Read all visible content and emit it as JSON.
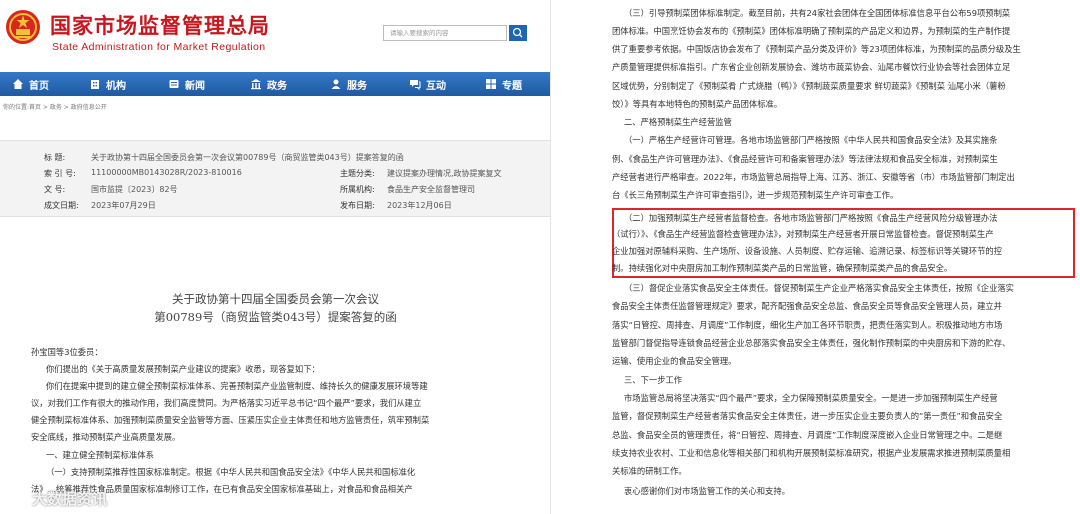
{
  "site": {
    "name_cn": "国家市场监督管理总局",
    "name_en": "State Administration for Market Regulation",
    "search_placeholder": "请输入要搜索的内容"
  },
  "nav": [
    {
      "label": "首页",
      "icon": "home-icon"
    },
    {
      "label": "机构",
      "icon": "building-icon"
    },
    {
      "label": "新闻",
      "icon": "news-icon"
    },
    {
      "label": "政务",
      "icon": "government-icon"
    },
    {
      "label": "服务",
      "icon": "service-icon"
    },
    {
      "label": "互动",
      "icon": "interaction-icon"
    },
    {
      "label": "专题",
      "icon": "topic-icon"
    }
  ],
  "breadcrumb": "你的位置:首页 > 政务 > 政府信息公开",
  "meta": {
    "title_label": "标 题:",
    "title_value": "关于政协第十四届全国委员会第一次会议第00789号（商贸监管类043号）提案答复的函",
    "index_label": "索 引 号:",
    "index_value": "11100000MB0143028R/2023-810016",
    "subject_label": "主题分类:",
    "subject_value": "建议提案办理情况,政协提案复文",
    "docno_label": "文 号:",
    "docno_value": "国市监提〔2023〕82号",
    "org_label": "所属机构:",
    "org_value": "食品生产安全监督管理司",
    "created_label": "成文日期:",
    "created_value": "2023年07月29日",
    "published_label": "发布日期:",
    "published_value": "2023年12月06日"
  },
  "document_title": {
    "line1": "关于政协第十四届全国委员会第一次会议",
    "line2": "第00789号（商贸监管类043号）提案答复的函"
  },
  "left_body": [
    "孙宝国等3位委员：",
    "你们提出的《关于高质量发展预制菜产业建议的提案》收悉，现答复如下：",
    "你们在提案中提到的建立健全预制菜标准体系、完善预制菜产业监管制度、维持长久的健康发展环境等建",
    "议，对我们工作有很大的推动作用，我们高度赞同。为严格落实习近平总书记“四个最严”要求，我们从建立",
    "健全预制菜标准体系、加强预制菜质量安全监管等方面、压紧压实企业主体责任和地方监管责任，筑牢预制菜",
    "安全底线，推动预制菜产业高质量发展。",
    "一、建立健全预制菜标准体系",
    "（一）支持预制菜推荐性国家标准制定。根据《中华人民共和国食品安全法》《中华人民共和国标准化",
    "法》…统筹推荐性食品质量国家标准制修订工作，在已有食品安全国家标准基础上，对食品和食品相关产"
  ],
  "right_body": [
    "（三）引导预制菜团体标准制定。截至目前，共有24家社会团体在全国团体标准信息平台公布59项预制菜",
    "团体标准。中国烹饪协会发布的《预制菜》团体标准明确了预制菜的产品定义和边界，为预制菜的生产制作提",
    "供了重要参考依据。中国饭店协会发布了《预制菜产品分类及评价》等23项团体标准，为预制菜的品质分级及生",
    "产质量管理提供标准指引。广东省企业创新发展协会、潍坊市蔬菜协会、汕尾市餐饮行业协会等社会团体立足",
    "区域优势，分别制定了《预制菜肴 广式烧腊（鸭）》《预制蔬菜质量要求 鲜切蔬菜》《预制菜 汕尾小米（薯粉",
    "饺）》等具有本地特色的预制菜产品团体标准。",
    "二、严格预制菜生产经营监管",
    "（一）严格生产经营许可管理。各地市场监管部门严格按照《中华人民共和国食品安全法》及其实施条",
    "例、《食品生产许可管理办法》、《食品经营许可和备案管理办法》等法律法规和食品安全标准，对预制菜生",
    "产经营者进行严格审查。2022年，市场监管总局指导上海、江苏、浙江、安徽等省（市）市场监管部门制定出",
    "台《长三角预制菜生产许可审查指引》，进一步规范预制菜生产许可审查工作。",
    "（二）加强预制菜生产经营者监督检查。各地市场监管部门严格按照《食品生产经营风险分级管理办法",
    "（试行）》、《食品生产经营监督检查管理办法》，对预制菜生产经营者开展日常监督检查。督促预制菜生产",
    "企业加强对原辅料采购、生产场所、设备设施、人员制度、贮存运输、追溯记录、标签标识等关键环节的控",
    "制。持续强化对中央厨房加工制作预制菜类产品的日常监管，确保预制菜类产品的食品安全。",
    "（三）督促企业落实食品安全主体责任。督促预制菜生产企业严格落实食品安全主体责任，按照《企业落实",
    "食品安全主体责任监督管理规定》要求，配齐配强食品安全总监、食品安全员等食品安全管理人员，建立并",
    "落实“日管控、周排查、月调度”工作制度，细化生产加工各环节职责，把责任落实到人。积极推动地方市场",
    "监管部门督促指导连锁食品经营企业总部落实食品安全主体责任，强化制作预制菜的中央厨房和下游的贮存、",
    "运输、使用企业的食品安全管理。",
    "三、下一步工作",
    "市场监管总局将坚决落实“四个最严”要求，全力保障预制菜质量安全。一是进一步加强预制菜生产经营",
    "监管，督促预制菜生产经营者落实食品安全主体责任，进一步压实企业主要负责人的“第一责任”和食品安全",
    "总监、食品安全员的管理责任，将“日管控、周排查、月调度”工作制度深度嵌入企业日常管理之中。二是继",
    "续支持农业农村、工业和信息化等相关部门和机构开展预制菜标准研究，根据产业发展需求推进预制菜质量相",
    "关标准的研制工作。",
    "衷心感谢你们对市场监管工作的关心和支持。"
  ],
  "watermark": "大数据资讯"
}
